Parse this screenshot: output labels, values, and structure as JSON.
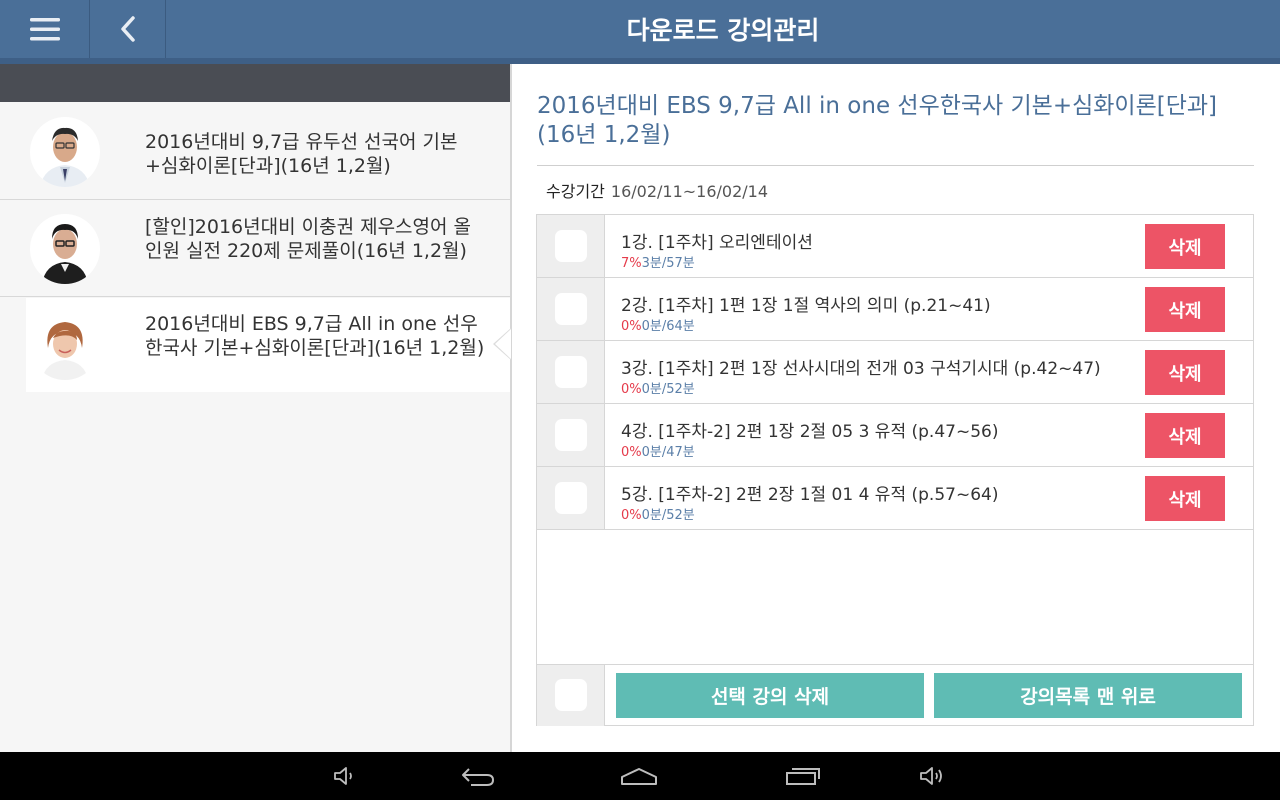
{
  "header": {
    "title": "다운로드 강의관리"
  },
  "courses": [
    {
      "title": "2016년대비 9,7급 유두선 선국어 기본+심화이론[단과](16년 1,2월)"
    },
    {
      "title": "[할인]2016년대비 이충권 제우스영어 올인원 실전 220제 문제풀이(16년 1,2월)"
    },
    {
      "title": "2016년대비 EBS 9,7급 All in one 선우한국사 기본+심화이론[단과](16년 1,2월)"
    }
  ],
  "detail": {
    "title": "2016년대비 EBS 9,7급 All in one 선우한국사 기본+심화이론[단과](16년 1,2월)",
    "period_label": "수강기간",
    "period_value": "16/02/11~16/02/14",
    "delete_label": "삭제",
    "lectures": [
      {
        "title": "1강. [1주차] 오리엔테이션",
        "progress": "7%",
        "time": "3분/57분"
      },
      {
        "title": "2강. [1주차] 1편 1장 1절 역사의 의미 (p.21~41)",
        "progress": "0%",
        "time": "0분/64분"
      },
      {
        "title": "3강. [1주차] 2편 1장 선사시대의 전개 03 구석기시대 (p.42~47)",
        "progress": "0%",
        "time": "0분/52분"
      },
      {
        "title": "4강. [1주차-2] 2편 1장 2절 05 3 유적 (p.47~56)",
        "progress": "0%",
        "time": "0분/47분"
      },
      {
        "title": "5강. [1주차-2] 2편 2장 1절 01 4 유적 (p.57~64)",
        "progress": "0%",
        "time": "0분/52분"
      }
    ],
    "delete_selected_label": "선택 강의 삭제",
    "scroll_top_label": "강의목록 맨 위로"
  },
  "icons": {
    "menu": "hamburger-menu-icon",
    "back": "chevron-left-icon",
    "nav": [
      "volume-down-icon",
      "back-icon",
      "home-icon",
      "recent-apps-icon",
      "volume-up-icon"
    ]
  },
  "colors": {
    "header": "#4a6f98",
    "accent_red": "#ed5466",
    "accent_teal": "#5fbcb4",
    "progress_red": "#e53b4b",
    "time_blue": "#5b7fa8"
  }
}
